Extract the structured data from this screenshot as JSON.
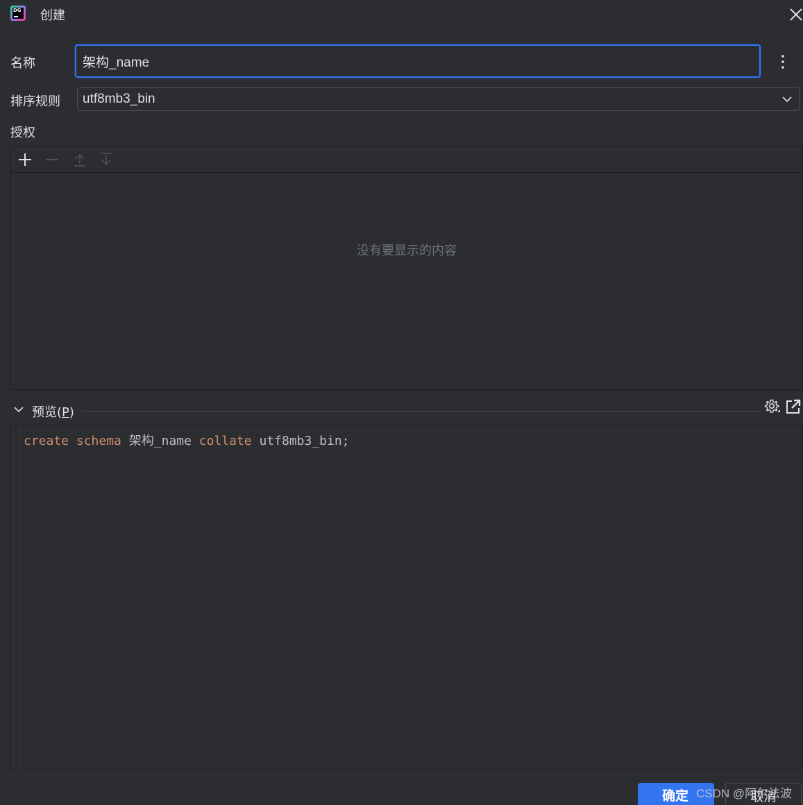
{
  "window": {
    "title": "创建",
    "logo_text": "DG",
    "logo_icon": "datagrip-logo-icon",
    "close_icon": "close-icon"
  },
  "form": {
    "name_label": "名称",
    "name_value": "架构_name",
    "collation_label": "排序规则",
    "collation_value": "utf8mb3_bin",
    "permissions_label": "授权"
  },
  "permissions": {
    "toolbar": [
      "add-icon",
      "remove-icon",
      "move-up-icon",
      "move-down-icon"
    ],
    "empty_text": "没有要显示的内容"
  },
  "preview": {
    "title_prefix": "预览(",
    "title_mnemonic": "P",
    "title_suffix": ")",
    "code_tokens": [
      {
        "text": "create",
        "kind": "keyword"
      },
      {
        "text": " ",
        "kind": "plain"
      },
      {
        "text": "schema",
        "kind": "keyword"
      },
      {
        "text": " 架构_name ",
        "kind": "plain"
      },
      {
        "text": "collate",
        "kind": "keyword"
      },
      {
        "text": " utf8mb3_bin;",
        "kind": "plain"
      }
    ]
  },
  "buttons": {
    "ok_label": "确定",
    "cancel_label": "取消"
  },
  "watermark": "CSDN @阿尔法波",
  "colors": {
    "background": "#2b2d30",
    "accent": "#3574f0",
    "keyword": "#cf8e6d",
    "muted": "#6f737a"
  }
}
